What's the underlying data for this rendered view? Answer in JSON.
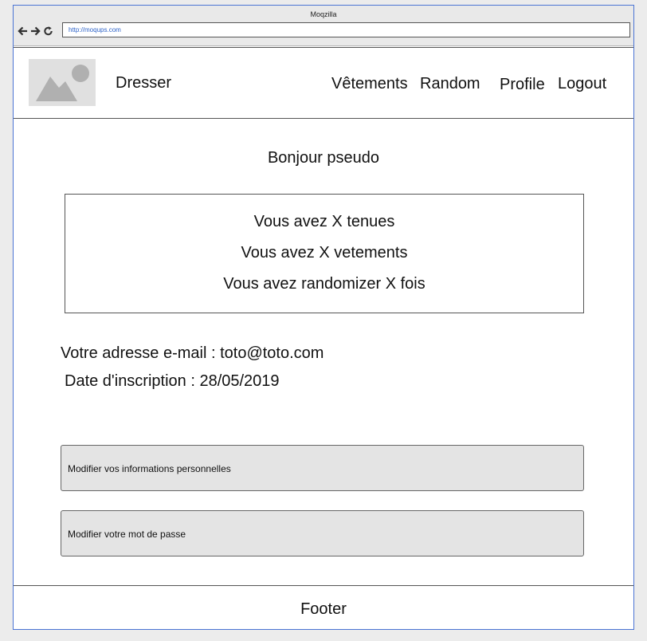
{
  "browser": {
    "window_title": "Moqzilla",
    "url": "http://moqups.com",
    "nav_icons": [
      "arrow-left-icon",
      "arrow-right-icon",
      "reload-icon"
    ]
  },
  "header": {
    "logo_icon": "image-placeholder-icon",
    "brand": "Dresser",
    "nav": [
      {
        "label": "Vêtements"
      },
      {
        "label": "Random"
      },
      {
        "label": "Profile"
      },
      {
        "label": "Logout"
      }
    ]
  },
  "main": {
    "greeting": "Bonjour pseudo",
    "stats": [
      "Vous avez X tenues",
      "Vous avez X vetements",
      "Vous avez randomizer X fois"
    ],
    "email_line": "Votre adresse e-mail : toto@toto.com",
    "date_line": "Date d'inscription : 28/05/2019",
    "buttons": [
      {
        "label": "Modifier vos informations personnelles"
      },
      {
        "label": "Modifier votre mot de passe"
      }
    ]
  },
  "footer": {
    "text": "Footer"
  },
  "colors": {
    "frame_border": "#4a74d4",
    "url_text": "#2e63c8",
    "button_bg": "#e4e4e4",
    "placeholder_bg": "#e0e0e0",
    "placeholder_fg": "#b0b0b0"
  }
}
